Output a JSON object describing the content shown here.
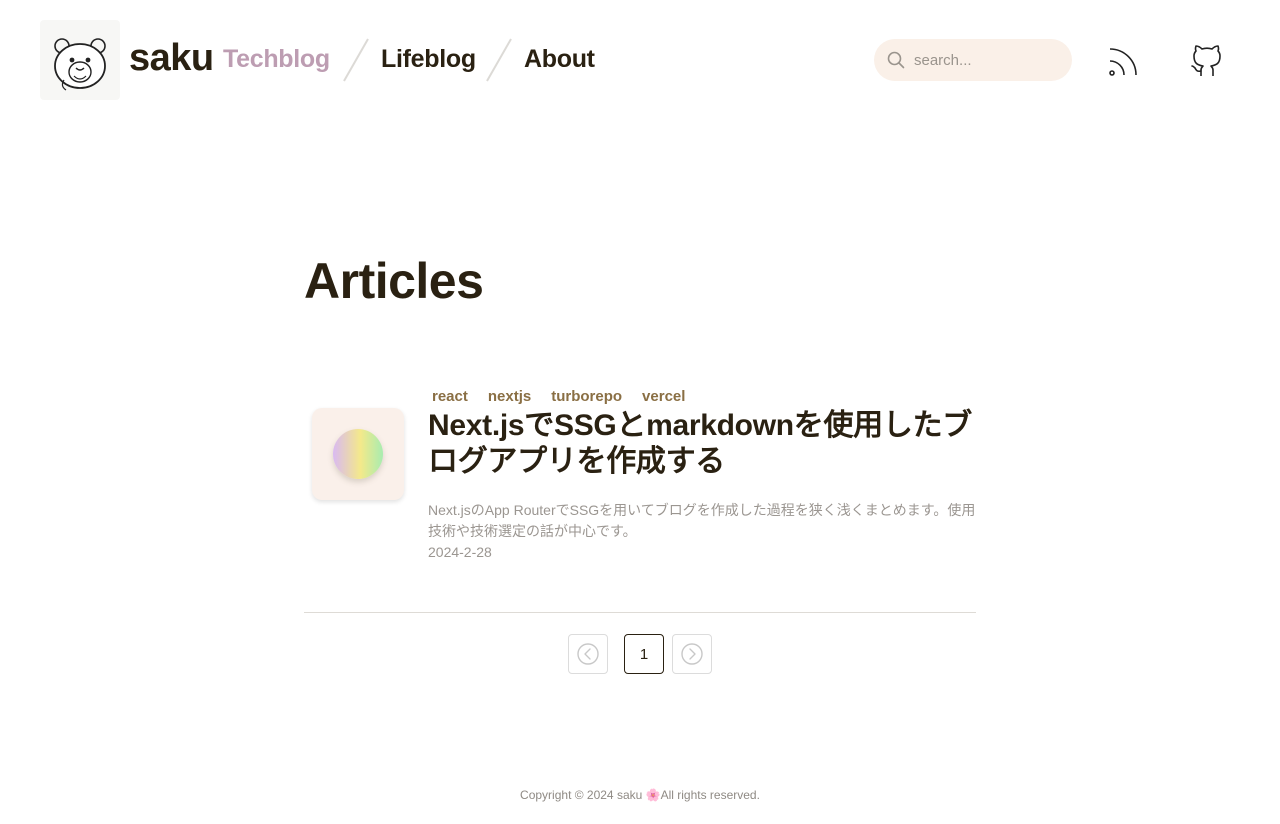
{
  "header": {
    "site_name": "saku",
    "nav": [
      {
        "label": "Techblog",
        "active": true
      },
      {
        "label": "Lifeblog",
        "active": false
      },
      {
        "label": "About",
        "active": false
      }
    ],
    "search": {
      "placeholder": "search..."
    },
    "icons": {
      "search": "search-icon",
      "rss": "rss-icon",
      "github": "github-icon",
      "logo": "bear-logo"
    }
  },
  "main": {
    "title": "Articles",
    "articles": [
      {
        "tags": [
          "react",
          "nextjs",
          "turborepo",
          "vercel"
        ],
        "title": "Next.jsでSSGとmarkdownを使用したブログアプリを作成する",
        "description": "Next.jsのApp RouterでSSGを用いてブログを作成した過程を狭く浅くまとめます。使用技術や技術選定の話が中心です。",
        "date": "2024-2-28"
      }
    ],
    "pagination": {
      "current": "1"
    }
  },
  "footer": {
    "copyright": "Copyright © 2024 saku 🌸All rights reserved."
  },
  "colors": {
    "text": "#2a2112",
    "nav_active": "#bd9db2",
    "tag": "#8a6f44",
    "search_bg": "#faf0e8",
    "muted": "#9b9691"
  }
}
